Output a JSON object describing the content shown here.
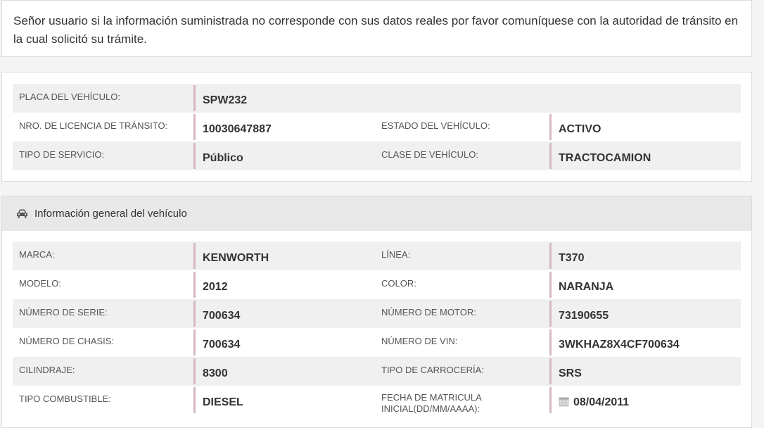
{
  "notice": {
    "text": "Señor usuario si la información suministrada no corresponde con sus datos reales por favor comuníquese con la autoridad de tránsito en la cual solicitó su trámite."
  },
  "summary": {
    "rows": [
      {
        "label1": "PLACA DEL VEHÍCULO:",
        "value1": "SPW232",
        "label2": "",
        "value2": ""
      },
      {
        "label1": "NRO. DE LICENCIA DE TRÁNSITO:",
        "value1": "10030647887",
        "label2": "ESTADO DEL VEHÍCULO:",
        "value2": "ACTIVO"
      },
      {
        "label1": "TIPO DE SERVICIO:",
        "value1": "Público",
        "label2": "CLASE DE VEHÍCULO:",
        "value2": "TRACTOCAMION"
      }
    ]
  },
  "general": {
    "heading": "Información general del vehículo",
    "icon": "car-icon",
    "rows": [
      {
        "label1": "MARCA:",
        "value1": "KENWORTH",
        "label2": "LÍNEA:",
        "value2": "T370"
      },
      {
        "label1": "MODELO:",
        "value1": "2012",
        "label2": "COLOR:",
        "value2": "NARANJA"
      },
      {
        "label1": "NÚMERO DE SERIE:",
        "value1": "700634",
        "label2": "NÚMERO DE MOTOR:",
        "value2": "73190655"
      },
      {
        "label1": "NÚMERO DE CHASIS:",
        "value1": "700634",
        "label2": "NÚMERO DE VIN:",
        "value2": "3WKHAZ8X4CF700634"
      },
      {
        "label1": "CILINDRAJE:",
        "value1": "8300",
        "label2": "TIPO DE CARROCERÍA:",
        "value2": "SRS"
      },
      {
        "label1": "TIPO COMBUSTIBLE:",
        "value1": "DIESEL",
        "label2": "FECHA DE MATRICULA INICIAL(DD/MM/AAAA):",
        "value2": "08/04/2011"
      }
    ]
  }
}
